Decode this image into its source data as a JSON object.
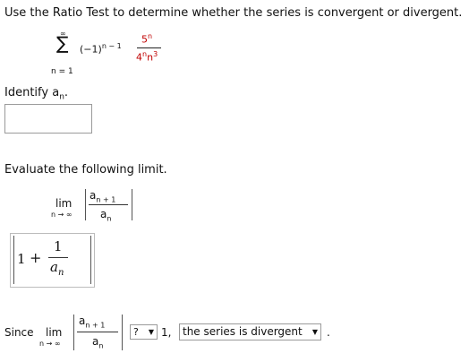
{
  "prompt": "Use the Ratio Test to determine whether the series is convergent or divergent.",
  "series": {
    "sigma": "∑",
    "upper": "∞",
    "lower": "n = 1",
    "sign_base": "(−1)",
    "sign_exp": "n − 1",
    "num_base": "5",
    "num_exp": "n",
    "den_base1": "4",
    "den_exp1": "n",
    "den_base2": "n",
    "den_exp2": "3"
  },
  "identify": {
    "label": "Identify a",
    "sub": "n",
    "tail": ".",
    "answer_value": ""
  },
  "evaluate": {
    "label": "Evaluate the following limit.",
    "lim": "lim",
    "lim_sub": "n → ∞",
    "num": "a",
    "num_sub": "n + 1",
    "den": "a",
    "den_sub": "n"
  },
  "entry": {
    "one": "1",
    "plus": "+",
    "num": "1",
    "den": "a",
    "den_sub": "n"
  },
  "conclusion": {
    "since": "Since",
    "lim": "lim",
    "lim_sub": "n → ∞",
    "num": "a",
    "num_sub": "n + 1",
    "den": "a",
    "den_sub": "n",
    "comparison_selected": "?",
    "after_comparison": "1,",
    "result_selected": "the series is divergent",
    "period": "."
  },
  "icons": {
    "dropdown": "▼"
  }
}
